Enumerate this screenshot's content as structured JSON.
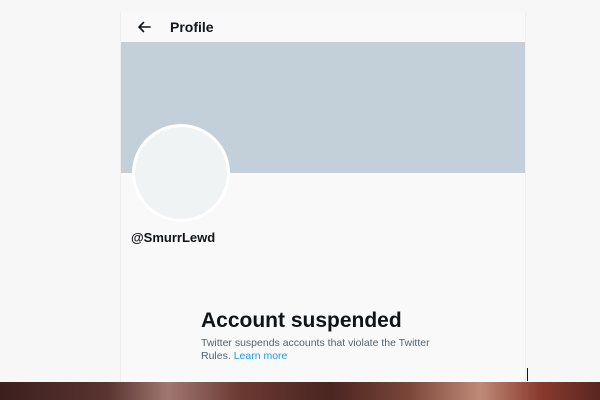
{
  "header": {
    "back_icon": "arrow-left-icon",
    "title": "Profile"
  },
  "colors": {
    "banner": "#c3cfd9",
    "avatar": "#eff3f4",
    "link": "#1d9bf0",
    "secondary_text": "#536471"
  },
  "profile": {
    "handle": "@SmurrLewd"
  },
  "suspension": {
    "title": "Account suspended",
    "message": "Twitter suspends accounts that violate the Twitter Rules.",
    "link_label": "Learn more"
  }
}
